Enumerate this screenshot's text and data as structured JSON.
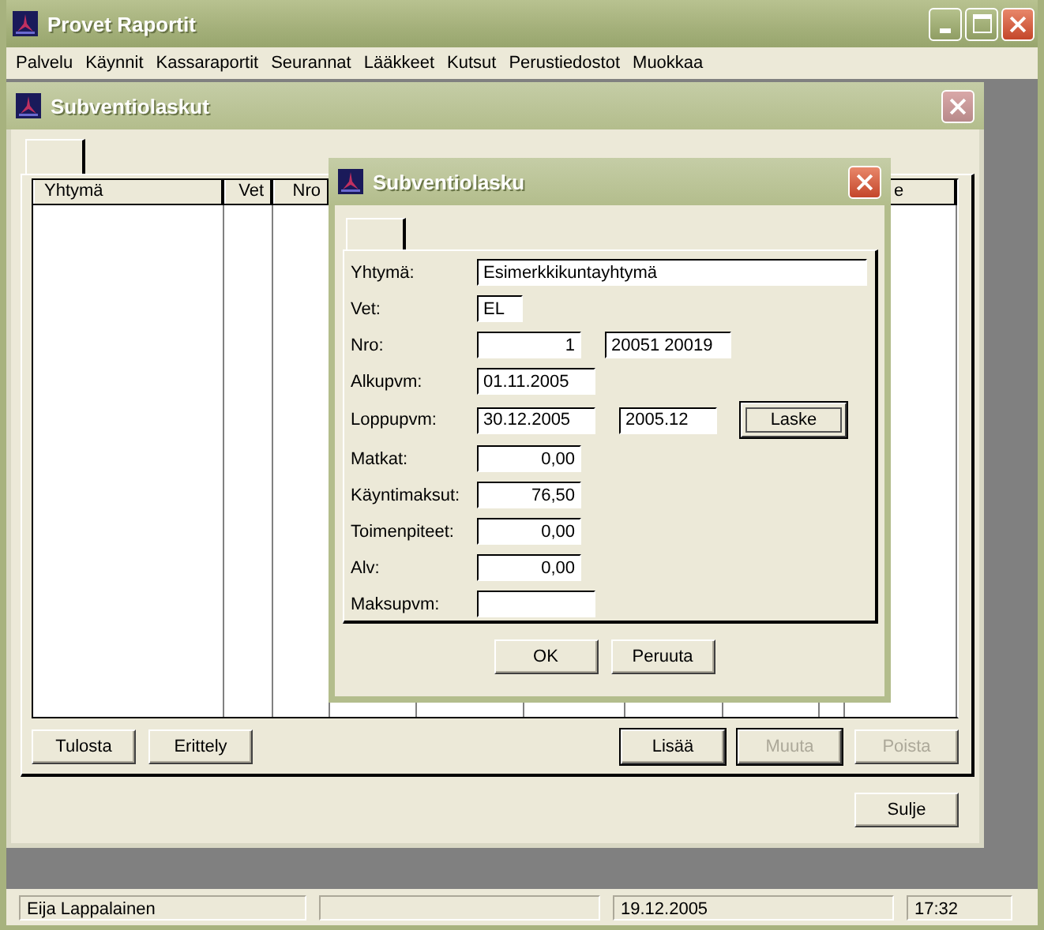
{
  "window": {
    "title": "Provet Raportit"
  },
  "menu": [
    "Palvelu",
    "Käynnit",
    "Kassaraportit",
    "Seurannat",
    "Lääkkeet",
    "Kutsut",
    "Perustiedostot",
    "Muokkaa"
  ],
  "child_window": {
    "title": "Subventiolaskut",
    "table": {
      "columns": [
        {
          "label": "Yhtymä"
        },
        {
          "label": "Vet"
        },
        {
          "label": "Nro"
        },
        {
          "label": "e"
        }
      ]
    },
    "left_buttons": [
      {
        "label": "Tulosta",
        "disabled": false,
        "default": false
      },
      {
        "label": "Erittely",
        "disabled": false,
        "default": false
      }
    ],
    "right_buttons": [
      {
        "label": "Lisää",
        "disabled": false,
        "default": true
      },
      {
        "label": "Muuta",
        "disabled": true,
        "default": true
      },
      {
        "label": "Poista",
        "disabled": true,
        "default": false
      }
    ],
    "close_button": {
      "label": "Sulje"
    }
  },
  "dialog": {
    "title": "Subventiolasku",
    "rows": [
      {
        "label": "Yhtymä:",
        "fields": [
          {
            "kind": "name",
            "value": "Esimerkkikuntayhtymä"
          }
        ]
      },
      {
        "label": "Vet:",
        "fields": [
          {
            "kind": "code",
            "value": "EL"
          }
        ]
      },
      {
        "label": "Nro:",
        "fields": [
          {
            "kind": "number",
            "value": "1"
          },
          {
            "kind": "ref",
            "value": "20051 20019"
          }
        ]
      },
      {
        "label": "Alkupvm:",
        "fields": [
          {
            "kind": "date",
            "value": "01.11.2005"
          }
        ]
      },
      {
        "label": "Loppupvm:",
        "fields": [
          {
            "kind": "date",
            "value": "30.12.2005"
          },
          {
            "kind": "period",
            "value": "2005.12"
          }
        ],
        "button": {
          "label": "Laske",
          "focused": true
        }
      },
      {
        "label": "Matkat:",
        "fields": [
          {
            "kind": "number",
            "value": "0,00"
          }
        ]
      },
      {
        "label": "Käyntimaksut:",
        "fields": [
          {
            "kind": "number",
            "value": "76,50"
          }
        ]
      },
      {
        "label": "Toimenpiteet:",
        "fields": [
          {
            "kind": "number",
            "value": "0,00"
          }
        ]
      },
      {
        "label": "Alv:",
        "fields": [
          {
            "kind": "number",
            "value": "0,00"
          }
        ]
      },
      {
        "label": "Maksupvm:",
        "fields": [
          {
            "kind": "date"
          }
        ]
      }
    ],
    "buttons": [
      {
        "label": "OK"
      },
      {
        "label": "Peruuta"
      }
    ]
  },
  "status_bar": {
    "user": "Eija Lappalainen",
    "date": "19.12.2005",
    "time": "17:32"
  }
}
